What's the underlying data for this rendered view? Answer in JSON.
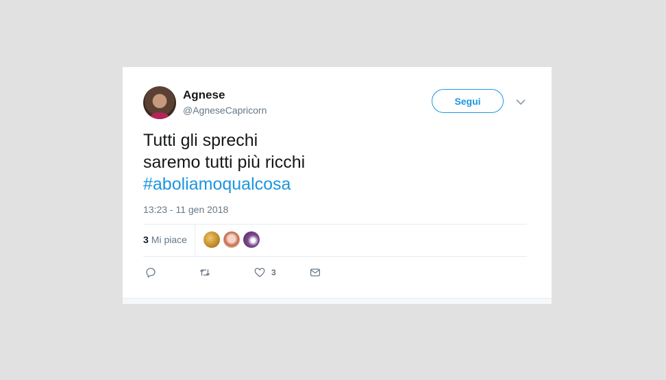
{
  "author": {
    "name": "Agnese",
    "handle": "@AgneseCapricorn"
  },
  "follow_button": {
    "label": "Segui"
  },
  "tweet": {
    "lines": [
      "Tutti gli sprechi",
      "saremo tutti più ricchi"
    ],
    "hashtag": "#aboliamoqualcosa",
    "timestamp": "13:23 - 11 gen 2018"
  },
  "stats": {
    "likes_count": "3",
    "likes_label": "Mi piace"
  },
  "actions": {
    "like_count": "3",
    "icons": [
      "reply-icon",
      "retweet-icon",
      "heart-icon",
      "envelope-icon"
    ]
  },
  "colors": {
    "accent": "#1b95e0",
    "text": "#14171a",
    "secondary": "#657786",
    "background": "#e1e1e1"
  }
}
